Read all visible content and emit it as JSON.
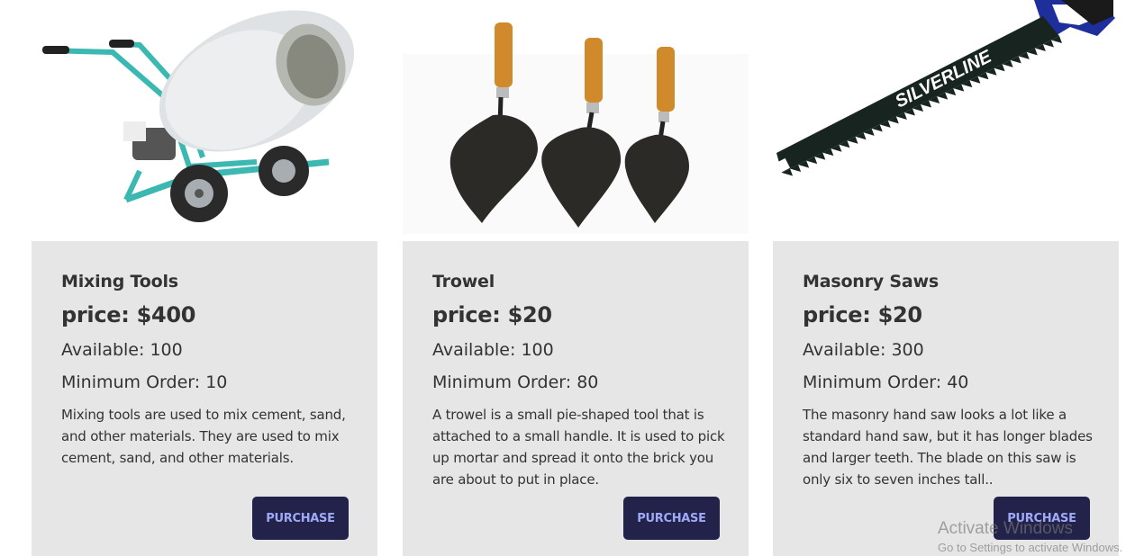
{
  "products": [
    {
      "image": "cement-mixer-image",
      "title": "Mixing Tools",
      "price": "price: $400",
      "available": "Available: 100",
      "min_order": "Minimum Order: 10",
      "description": "Mixing tools are used to mix cement, sand, and other materials. They are used to mix cement, sand, and other materials.",
      "button": "PURCHASE"
    },
    {
      "image": "trowels-image",
      "title": "Trowel",
      "price": "price: $20",
      "available": "Available: 100",
      "min_order": "Minimum Order: 80",
      "description": "A trowel is a small pie-shaped tool that is attached to a small handle. It is used to pick up mortar and spread it onto the brick you are about to put in place.",
      "button": "PURCHASE"
    },
    {
      "image": "masonry-saw-image",
      "title": "Masonry Saws",
      "price": "price: $20",
      "available": "Available: 300",
      "min_order": "Minimum Order: 40",
      "description": "The masonry hand saw looks a lot like a standard hand saw, but it has longer blades and larger teeth. The blade on this saw is only six to seven inches tall..",
      "button": "PURCHASE"
    }
  ],
  "saw_brand": "SILVERLINE",
  "watermark": {
    "title": "Activate Windows",
    "subtitle": "Go to Settings to activate Windows."
  },
  "colors": {
    "card_bg": "#e6e6e6",
    "button_bg": "#22224a",
    "button_text": "#9eaaf5",
    "text": "#333333"
  }
}
